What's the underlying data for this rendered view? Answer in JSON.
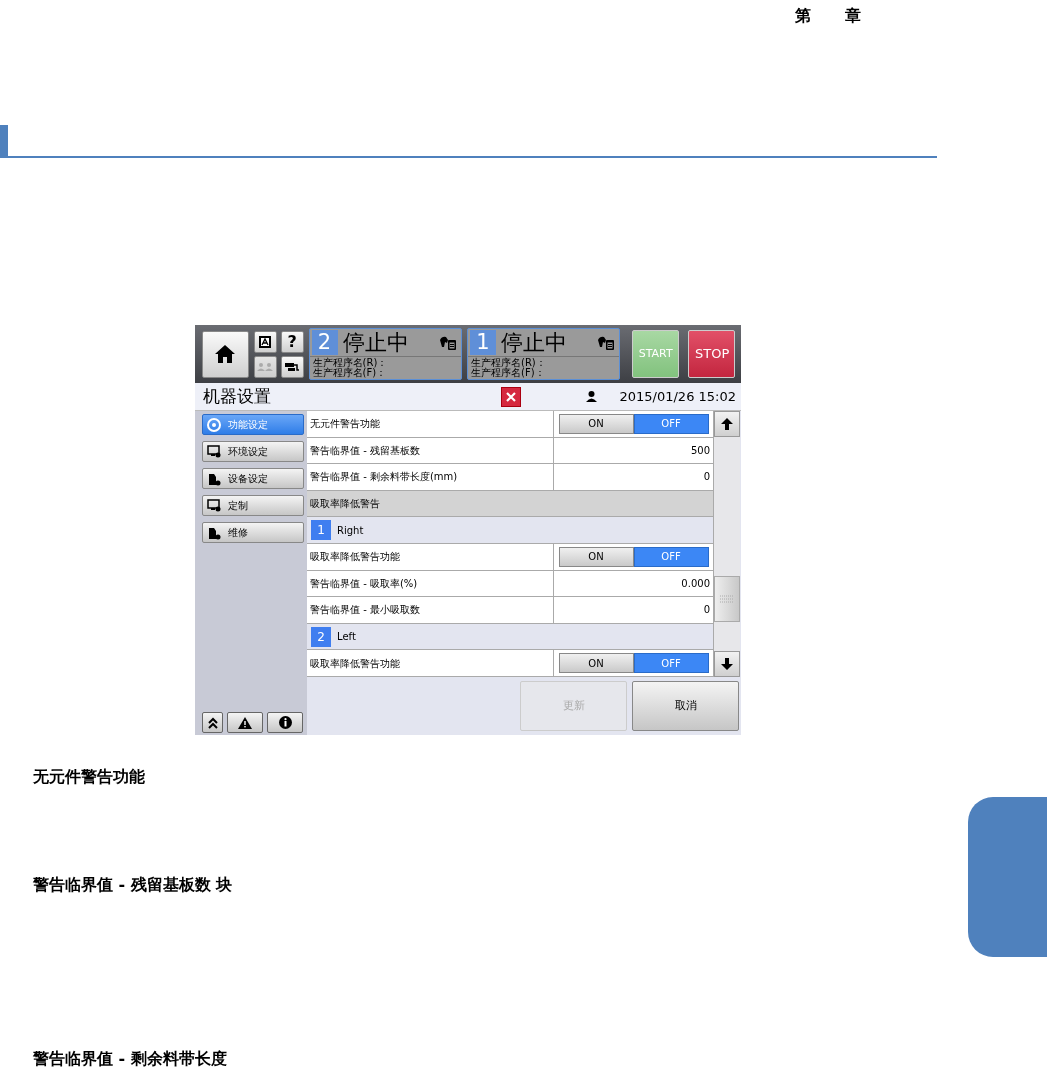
{
  "page": {
    "chapter_label": [
      "第",
      "章"
    ]
  },
  "screen": {
    "top_bar": {
      "buttons": [
        {
          "kind": "home",
          "disabled": false
        },
        {
          "kind": "language",
          "disabled": false
        },
        {
          "kind": "help",
          "label": "?",
          "disabled": false
        },
        {
          "kind": "operator",
          "disabled": true
        },
        {
          "kind": "connection",
          "disabled": false
        }
      ],
      "lanes": [
        {
          "number": "2",
          "status": "停止中",
          "program_lines": [
            "生产程序名(R)：",
            "生产程序名(F)："
          ]
        },
        {
          "number": "1",
          "status": "停止中",
          "program_lines": [
            "生产程序名(R)：",
            "生产程序名(F)："
          ]
        }
      ],
      "start": "START",
      "stop": "STOP"
    },
    "title_bar": {
      "title": "机器设置",
      "datetime": "2015/01/26 15:02"
    },
    "sidebar": {
      "items": [
        {
          "kind": "function",
          "label": "功能设定",
          "selected": true
        },
        {
          "kind": "environment",
          "label": "环境设定",
          "selected": false
        },
        {
          "kind": "device",
          "label": "设备设定",
          "selected": false
        },
        {
          "kind": "custom",
          "label": "定制",
          "selected": false
        },
        {
          "kind": "maintenance",
          "label": "维修",
          "selected": false
        }
      ],
      "bottom_buttons": [
        {
          "kind": "collapse"
        },
        {
          "kind": "warning"
        },
        {
          "kind": "info"
        }
      ]
    },
    "rows": [
      {
        "kind": "toggle",
        "label": "无元件警告功能",
        "options": [
          {
            "label": "ON",
            "selected": false
          },
          {
            "label": "OFF",
            "selected": true
          }
        ]
      },
      {
        "kind": "value",
        "label": "警告临界值 - 残留基板数",
        "value": "500"
      },
      {
        "kind": "value",
        "label": "警告临界值 - 剩余料带长度(mm)",
        "value": "0"
      },
      {
        "kind": "section",
        "label": "吸取率降低警告"
      },
      {
        "kind": "group",
        "number": "1",
        "label": "Right"
      },
      {
        "kind": "toggle",
        "label": "吸取率降低警告功能",
        "options": [
          {
            "label": "ON",
            "selected": false
          },
          {
            "label": "OFF",
            "selected": true
          }
        ]
      },
      {
        "kind": "value",
        "label": "警告临界值 - 吸取率(%)",
        "value": "0.000"
      },
      {
        "kind": "value",
        "label": "警告临界值 - 最小吸取数",
        "value": "0"
      },
      {
        "kind": "group",
        "number": "2",
        "label": "Left"
      },
      {
        "kind": "toggle",
        "label": "吸取率降低警告功能",
        "options": [
          {
            "label": "ON",
            "selected": false
          },
          {
            "label": "OFF",
            "selected": true
          }
        ]
      }
    ],
    "actions": [
      {
        "label": "更新",
        "disabled": true
      },
      {
        "label": "取消",
        "disabled": false
      }
    ]
  },
  "sections": [
    "无元件警告功能",
    "警告临界值 - 残留基板数 块",
    "警告临界值 - 剩余料带长度"
  ]
}
